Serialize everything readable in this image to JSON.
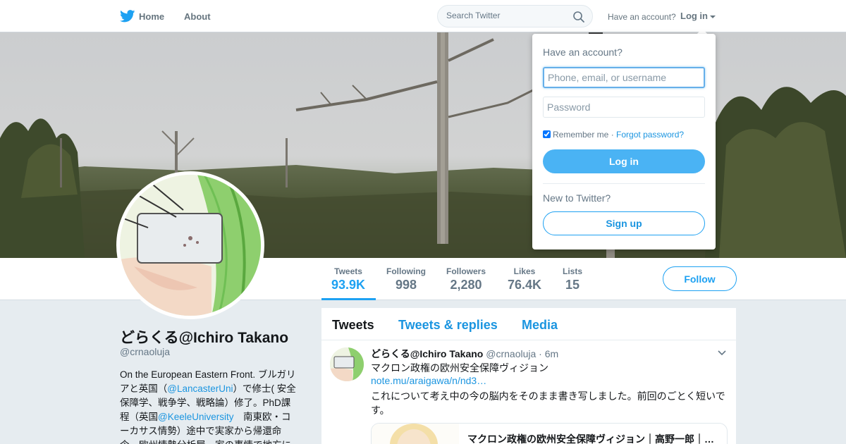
{
  "nav": {
    "home": "Home",
    "about": "About",
    "search_placeholder": "Search Twitter",
    "have_account": "Have an account?",
    "login": "Log in"
  },
  "profile": {
    "name": "どらくる@Ichiro Takano",
    "handle": "@crnaoluja",
    "bio_parts": {
      "p1": "On the European Eastern Front. ブルガリアと英国（",
      "m1": "@LancasterUni",
      "p2": "）で修士( 安全保障学、戦争学、戦略論）修了。PhD課程（英国",
      "m2": "@KeeleUniversity",
      "p3": "　南東欧・コーカサス情勢）途中で実家から帰還命令。欧州情勢分析屋。家の事情で地方に"
    }
  },
  "stats": {
    "tweets": {
      "label": "Tweets",
      "value": "93.9K"
    },
    "following": {
      "label": "Following",
      "value": "998"
    },
    "followers": {
      "label": "Followers",
      "value": "2,280"
    },
    "likes": {
      "label": "Likes",
      "value": "76.4K"
    },
    "lists": {
      "label": "Lists",
      "value": "15"
    }
  },
  "follow_label": "Follow",
  "timeline": {
    "tabs": [
      "Tweets",
      "Tweets & replies",
      "Media"
    ],
    "tweet": {
      "name": "どらくる@Ichiro Takano",
      "handle": "@crnaoluja",
      "time": "6m",
      "line1": "マクロン政権の欧州安全保障ヴィジョン",
      "link": "note.mu/araigawa/n/nd3…",
      "line2": "これについて考え中の今の脳内をそのまま書き写しました。前回のごとく短いです。",
      "card_title": "マクロン政権の欧州安全保障ヴィジョン｜高野一郎｜…"
    }
  },
  "login_dropdown": {
    "heading": "Have an account?",
    "username_placeholder": "Phone, email, or username",
    "password_placeholder": "Password",
    "remember": "Remember me",
    "separator": "·",
    "forgot": "Forgot password?",
    "login_button": "Log in",
    "new_prompt": "New to Twitter?",
    "signup_button": "Sign up"
  },
  "colors": {
    "accent": "#1da1f2",
    "link": "#1b95e0",
    "login_button": "#4ab3f4",
    "page_bg": "#e6ecf0"
  }
}
